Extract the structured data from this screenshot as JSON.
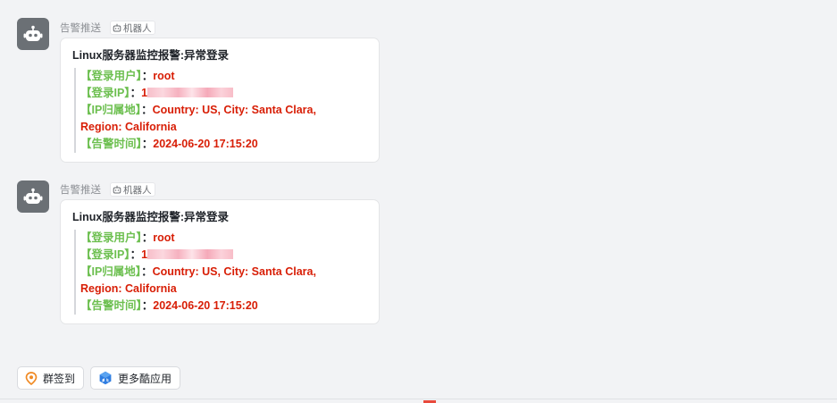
{
  "messages": [
    {
      "sender": "告警推送",
      "tag": "机器人",
      "title": "Linux服务器监控报警:异常登录",
      "fields": {
        "user": {
          "label": "【登录用户】",
          "sep": "：",
          "value": "root"
        },
        "ip": {
          "label": "【登录IP】",
          "sep": "：",
          "value": "1"
        },
        "location": {
          "label": "【IP归属地】",
          "sep": "：",
          "value": "Country: US, City: Santa Clara,",
          "value2": "Region: California"
        },
        "time": {
          "label": "【告警时间】",
          "sep": "：",
          "value": "2024-06-20 17:15:20"
        }
      }
    },
    {
      "sender": "告警推送",
      "tag": "机器人",
      "title": "Linux服务器监控报警:异常登录",
      "fields": {
        "user": {
          "label": "【登录用户】",
          "sep": "：",
          "value": "root"
        },
        "ip": {
          "label": "【登录IP】",
          "sep": "：",
          "value": "1"
        },
        "location": {
          "label": "【IP归属地】",
          "sep": "：",
          "value": "Country: US, City: Santa Clara,",
          "value2": "Region: California"
        },
        "time": {
          "label": "【告警时间】",
          "sep": "：",
          "value": "2024-06-20 17:15:20"
        }
      }
    }
  ],
  "bottom_bar": {
    "checkin_label": "群签到",
    "more_apps_label": "更多酷应用"
  },
  "icons": {
    "avatar": "robot-icon",
    "tag": "robot-tag-icon",
    "checkin": "location-pin-icon",
    "more_apps": "apps-icon"
  },
  "colors": {
    "label_green": "#6cbf4f",
    "value_red": "#d81e06",
    "avatar_bg": "#6b7075",
    "background": "#f2f3f5"
  }
}
